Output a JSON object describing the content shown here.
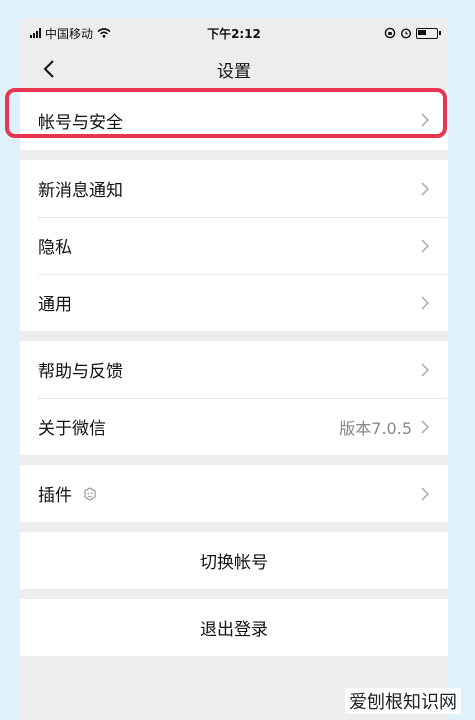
{
  "status_bar": {
    "carrier": "中国移动",
    "time": "下午2:12"
  },
  "nav": {
    "title": "设置"
  },
  "groups": [
    {
      "items": [
        {
          "label": "帐号与安全"
        }
      ]
    },
    {
      "items": [
        {
          "label": "新消息通知"
        },
        {
          "label": "隐私"
        },
        {
          "label": "通用"
        }
      ]
    },
    {
      "items": [
        {
          "label": "帮助与反馈"
        },
        {
          "label": "关于微信",
          "value": "版本7.0.5"
        }
      ]
    },
    {
      "items": [
        {
          "label": "插件"
        }
      ]
    }
  ],
  "actions": {
    "switch_account": "切换帐号",
    "logout": "退出登录"
  },
  "watermark": "爱刨根知识网",
  "colors": {
    "highlight": "#e8364f",
    "background": "#ededed",
    "outer": "#dff2fb"
  }
}
